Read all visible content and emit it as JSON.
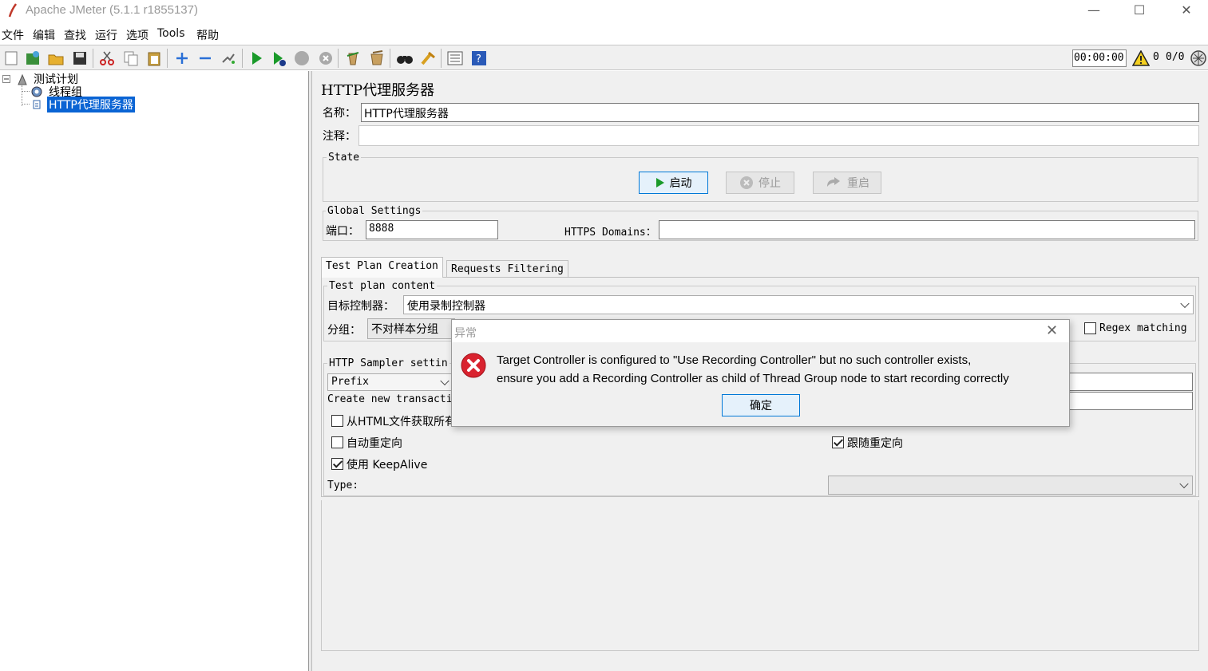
{
  "window": {
    "title": "Apache JMeter (5.1.1 r1855137)",
    "minimize_glyph": "—",
    "maximize_glyph": "☐",
    "close_glyph": "✕"
  },
  "menubar": {
    "items": [
      "文件",
      "编辑",
      "查找",
      "运行",
      "选项",
      "Tools",
      "帮助"
    ]
  },
  "toolbar": {
    "icons": [
      "new-icon",
      "templates-icon",
      "open-icon",
      "save-icon",
      "cut-icon",
      "copy-icon",
      "paste-icon",
      "expand-icon",
      "collapse-icon",
      "toggle-icon",
      "start-icon",
      "start-no-pause-icon",
      "stop-icon",
      "shutdown-icon",
      "clear-icon",
      "clear-all-icon",
      "search-icon",
      "reset-search-icon",
      "function-helper-icon",
      "help-icon"
    ],
    "timer": "00:00:00",
    "warning_count": "0",
    "thread_count": "0/0"
  },
  "tree": {
    "items": [
      {
        "label": "测试计划",
        "icon": "test-plan-icon"
      },
      {
        "label": "线程组",
        "icon": "gear-icon"
      },
      {
        "label": "HTTP代理服务器",
        "icon": "proxy-icon"
      }
    ]
  },
  "panel": {
    "title": "HTTP代理服务器",
    "name_label": "名称：",
    "name_value": "HTTP代理服务器",
    "comment_label": "注释：",
    "comment_value": "",
    "state": {
      "title": "State",
      "start_label": "启动",
      "stop_label": "停止",
      "restart_label": "重启"
    },
    "global": {
      "title": "Global Settings",
      "port_label": "端口：",
      "port_value": "8888",
      "https_label": "HTTPS Domains：",
      "https_value": ""
    },
    "tabs": [
      "Test Plan Creation",
      "Requests Filtering"
    ],
    "content": {
      "title": "Test plan content",
      "target_label": "目标控制器：",
      "target_value": "使用录制控制器",
      "group_label": "分组：",
      "group_value": "不对样本分组",
      "regex_label": "Regex matching"
    },
    "sampler": {
      "title": "HTTP Sampler settin",
      "prefix_value": "Prefix",
      "create_label": "Create new transacti",
      "fetch_label": "从HTML文件获取所有",
      "redirect_label": "自动重定向",
      "follow_label": "跟随重定向",
      "keepalive_label": "使用 KeepAlive",
      "type_label": "Type:"
    }
  },
  "dialog": {
    "title": "异常",
    "message_line1": "Target Controller is configured to \"Use Recording Controller\" but no such controller exists,",
    "message_line2": "ensure you add a Recording Controller as child of Thread Group node to start recording correctly",
    "ok_label": "确定",
    "error_color": "#d9232f"
  }
}
